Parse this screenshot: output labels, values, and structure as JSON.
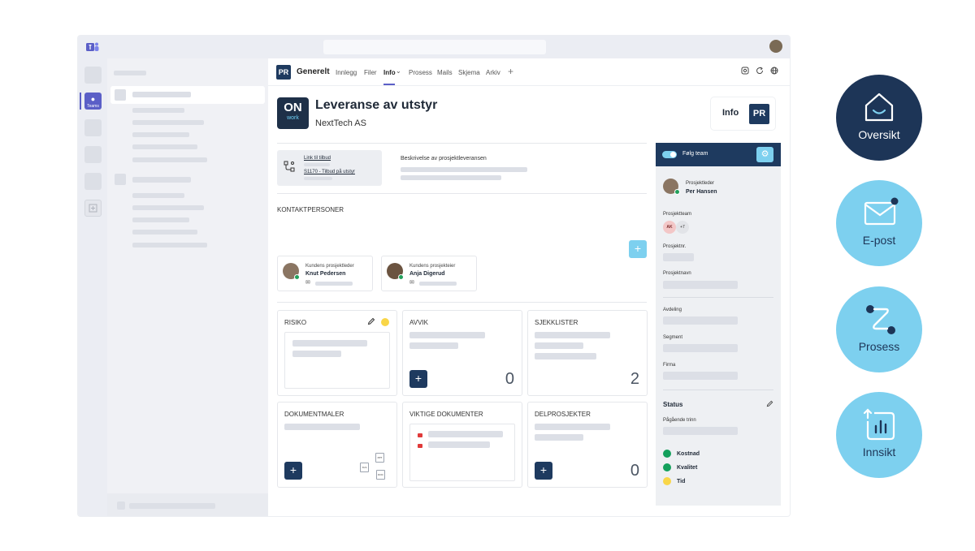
{
  "tabs": {
    "channel_initials": "PR",
    "channel_name": "Generelt",
    "items": [
      "Innlegg",
      "Filer",
      "Info",
      "Prosess",
      "Mails",
      "Skjema",
      "Arkiv"
    ],
    "info_chevron": "⌄",
    "add": "+"
  },
  "rail": {
    "teams_label": "Teams"
  },
  "header": {
    "logo_on": "ON",
    "logo_work": "work",
    "title": "Leveranse av utstyr",
    "company": "NextTech AS",
    "info_label": "Info",
    "info_initials": "PR"
  },
  "links": {
    "link1": "Link til tilbud",
    "link2": "S1170 - Tilbud på utstyr",
    "description_label": "Beskrivelse av prosjektleveransen"
  },
  "contacts": {
    "title": "Kontaktpersoner",
    "people": [
      {
        "role": "Kundens prosjektleder",
        "name": "Knut Pedersen"
      },
      {
        "role": "Kundens prosjekteier",
        "name": "Anja Digerud"
      }
    ]
  },
  "cards": [
    {
      "title": "Risiko"
    },
    {
      "title": "Avvik",
      "count": "0"
    },
    {
      "title": "Sjekklister",
      "count": "2"
    },
    {
      "title": "Dokumentmaler"
    },
    {
      "title": "Viktige dokumenter"
    },
    {
      "title": "Delprosjekter",
      "count": "0"
    }
  ],
  "file_icons": [
    "PPT",
    "XLS",
    "DOC"
  ],
  "sidebar": {
    "follow_label": "Følg team",
    "project_leader_label": "Prosjektleder",
    "project_leader_name": "Per Hansen",
    "team_label": "Prosjektteam",
    "team_chip": "AK",
    "team_more": "+7",
    "number_label": "Prosjektnr.",
    "name_label": "Prosjektnavn",
    "department_label": "Avdeling",
    "segment_label": "Segment",
    "firm_label": "Firma",
    "status_title": "Status",
    "current_step_label": "Pågående trinn",
    "status_items": [
      {
        "label": "Kostnad",
        "color": "#13a05c"
      },
      {
        "label": "Kvalitet",
        "color": "#13a05c"
      },
      {
        "label": "Tid",
        "color": "#f9d648"
      }
    ]
  },
  "features": [
    {
      "label": "Oversikt",
      "icon": "home-icon"
    },
    {
      "label": "E-post",
      "icon": "mail-icon"
    },
    {
      "label": "Prosess",
      "icon": "process-icon"
    },
    {
      "label": "Innsikt",
      "icon": "chart-icon"
    }
  ],
  "colors": {
    "navy": "#1e3a5f",
    "light_blue": "#7dd0ef",
    "teams_purple": "#5b5fc7"
  }
}
